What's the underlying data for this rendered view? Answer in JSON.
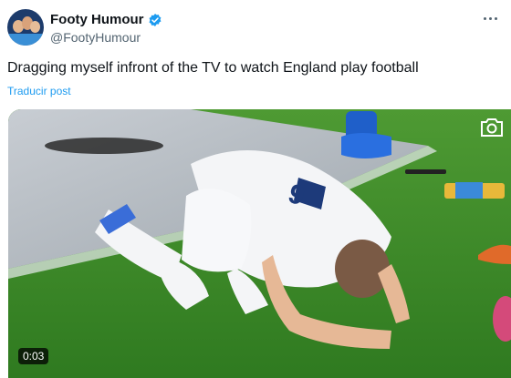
{
  "author": {
    "display_name": "Footy Humour",
    "handle": "@FootyHumour",
    "verified_icon": "verified-badge-icon",
    "verified_color": "#1d9bf0"
  },
  "post": {
    "text": "Dragging myself infront of the TV to watch England play football",
    "translate_label": "Traducir post"
  },
  "media": {
    "duration": "0:03",
    "shirt_number": "9",
    "camera_icon": "camera-icon"
  },
  "colors": {
    "link": "#1d9bf0",
    "secondary_text": "#536471",
    "pitch": "#3f8d2a"
  }
}
